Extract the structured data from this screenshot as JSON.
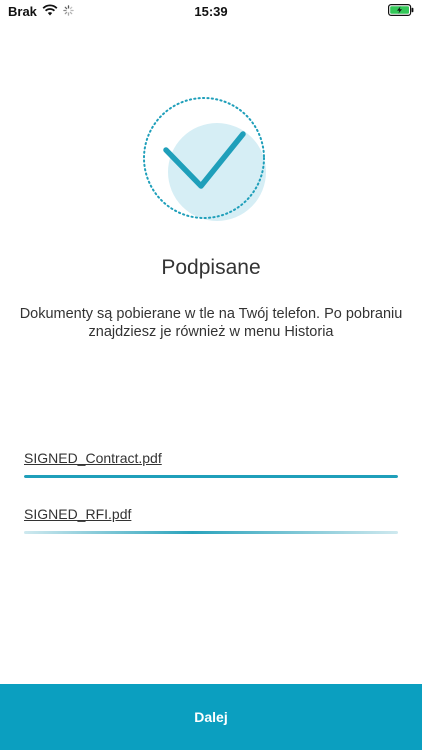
{
  "status_bar": {
    "carrier": "Brak",
    "time": "15:39"
  },
  "colors": {
    "accent": "#0b9fc0",
    "circle_fill": "#d6eef5",
    "checkmark": "#1f9fba"
  },
  "icons": {
    "hero": "check-circle-icon",
    "wifi": "wifi-icon",
    "activity": "activity-spinner-icon",
    "battery": "battery-charging-icon"
  },
  "main": {
    "title": "Podpisane",
    "description": "Dokumenty są pobierane w tle na Twój telefon. Po pobraniu znajdziesz je również w menu Historia"
  },
  "files": [
    {
      "name": "SIGNED_Contract.pdf",
      "progress": 1.0
    },
    {
      "name": "SIGNED_RFI.pdf",
      "progress": null
    }
  ],
  "footer": {
    "next_label": "Dalej"
  }
}
